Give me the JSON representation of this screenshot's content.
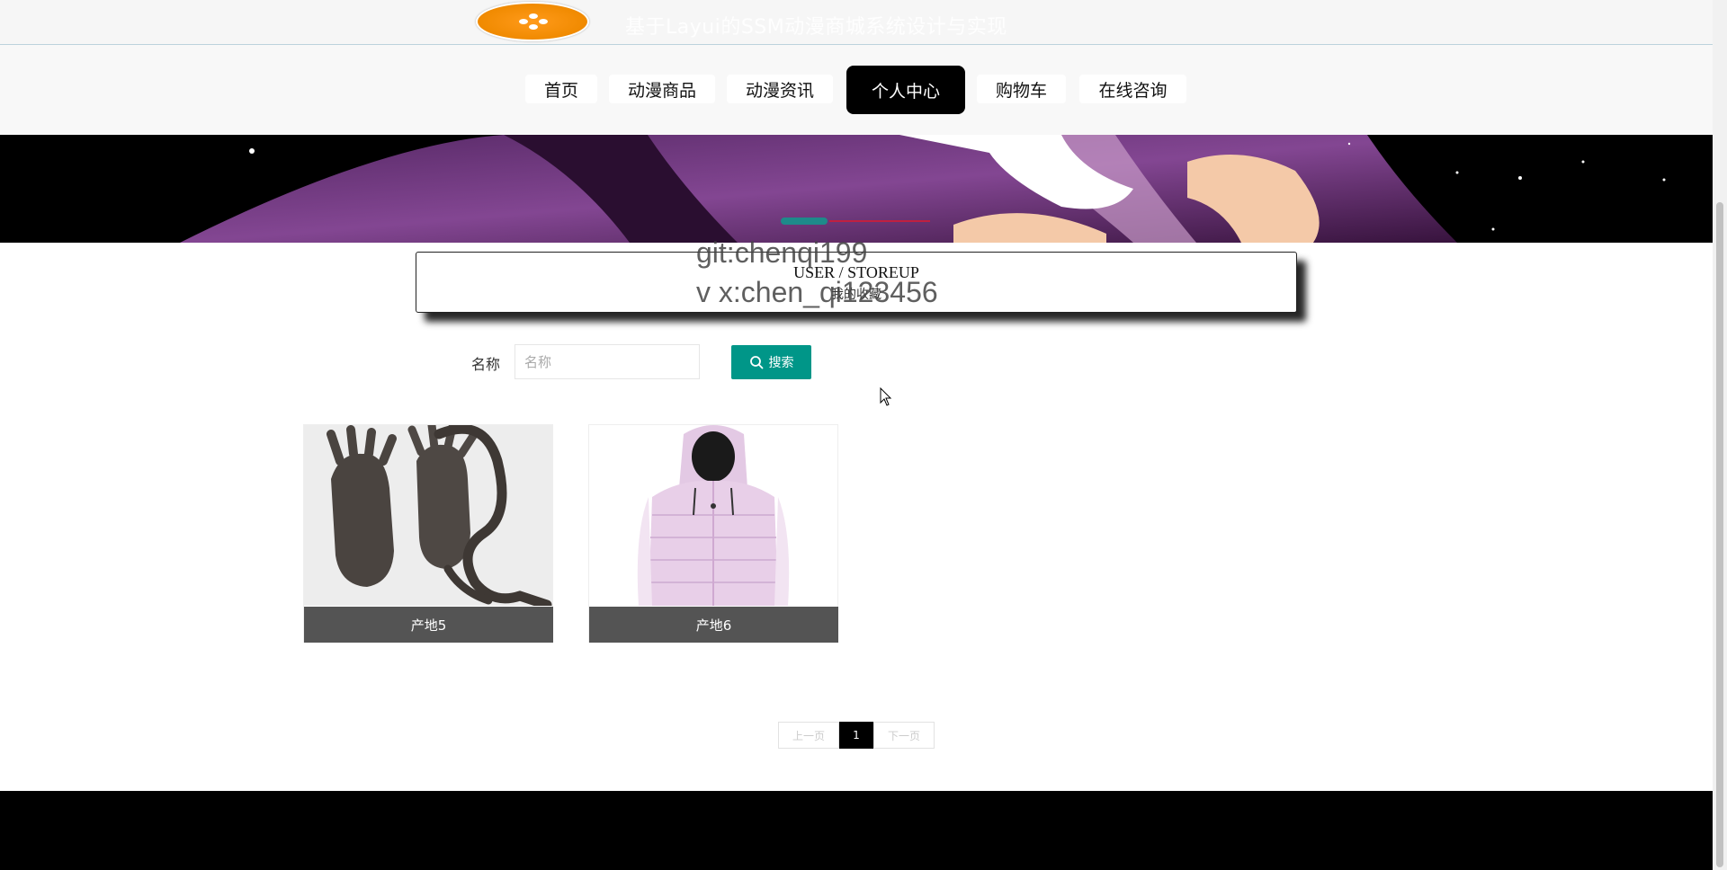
{
  "header": {
    "site_title": "基于Layui的SSM动漫商城系统设计与实现"
  },
  "nav": {
    "items": [
      {
        "label": "首页"
      },
      {
        "label": "动漫商品"
      },
      {
        "label": "动漫资讯"
      },
      {
        "label": "个人中心",
        "active": true
      },
      {
        "label": "购物车"
      },
      {
        "label": "在线咨询"
      }
    ]
  },
  "section": {
    "title_en": "USER / STOREUP",
    "title_cn": "我的收藏"
  },
  "watermark": {
    "line1": "git:chenqi199",
    "line2": "v x:chen_qi123456"
  },
  "search": {
    "label": "名称",
    "placeholder": "名称",
    "value": "",
    "button_label": "搜索"
  },
  "cards": [
    {
      "label": "产地5",
      "image": "fur-gloves-scarf"
    },
    {
      "label": "产地6",
      "image": "pink-puffer-vest"
    }
  ],
  "pagination": {
    "prev_label": "上一页",
    "current": "1",
    "next_label": "下一页"
  },
  "colors": {
    "accent": "#009688",
    "nav_active": "#000000",
    "card_label_bg": "#545454",
    "logo": "#f08a00"
  }
}
